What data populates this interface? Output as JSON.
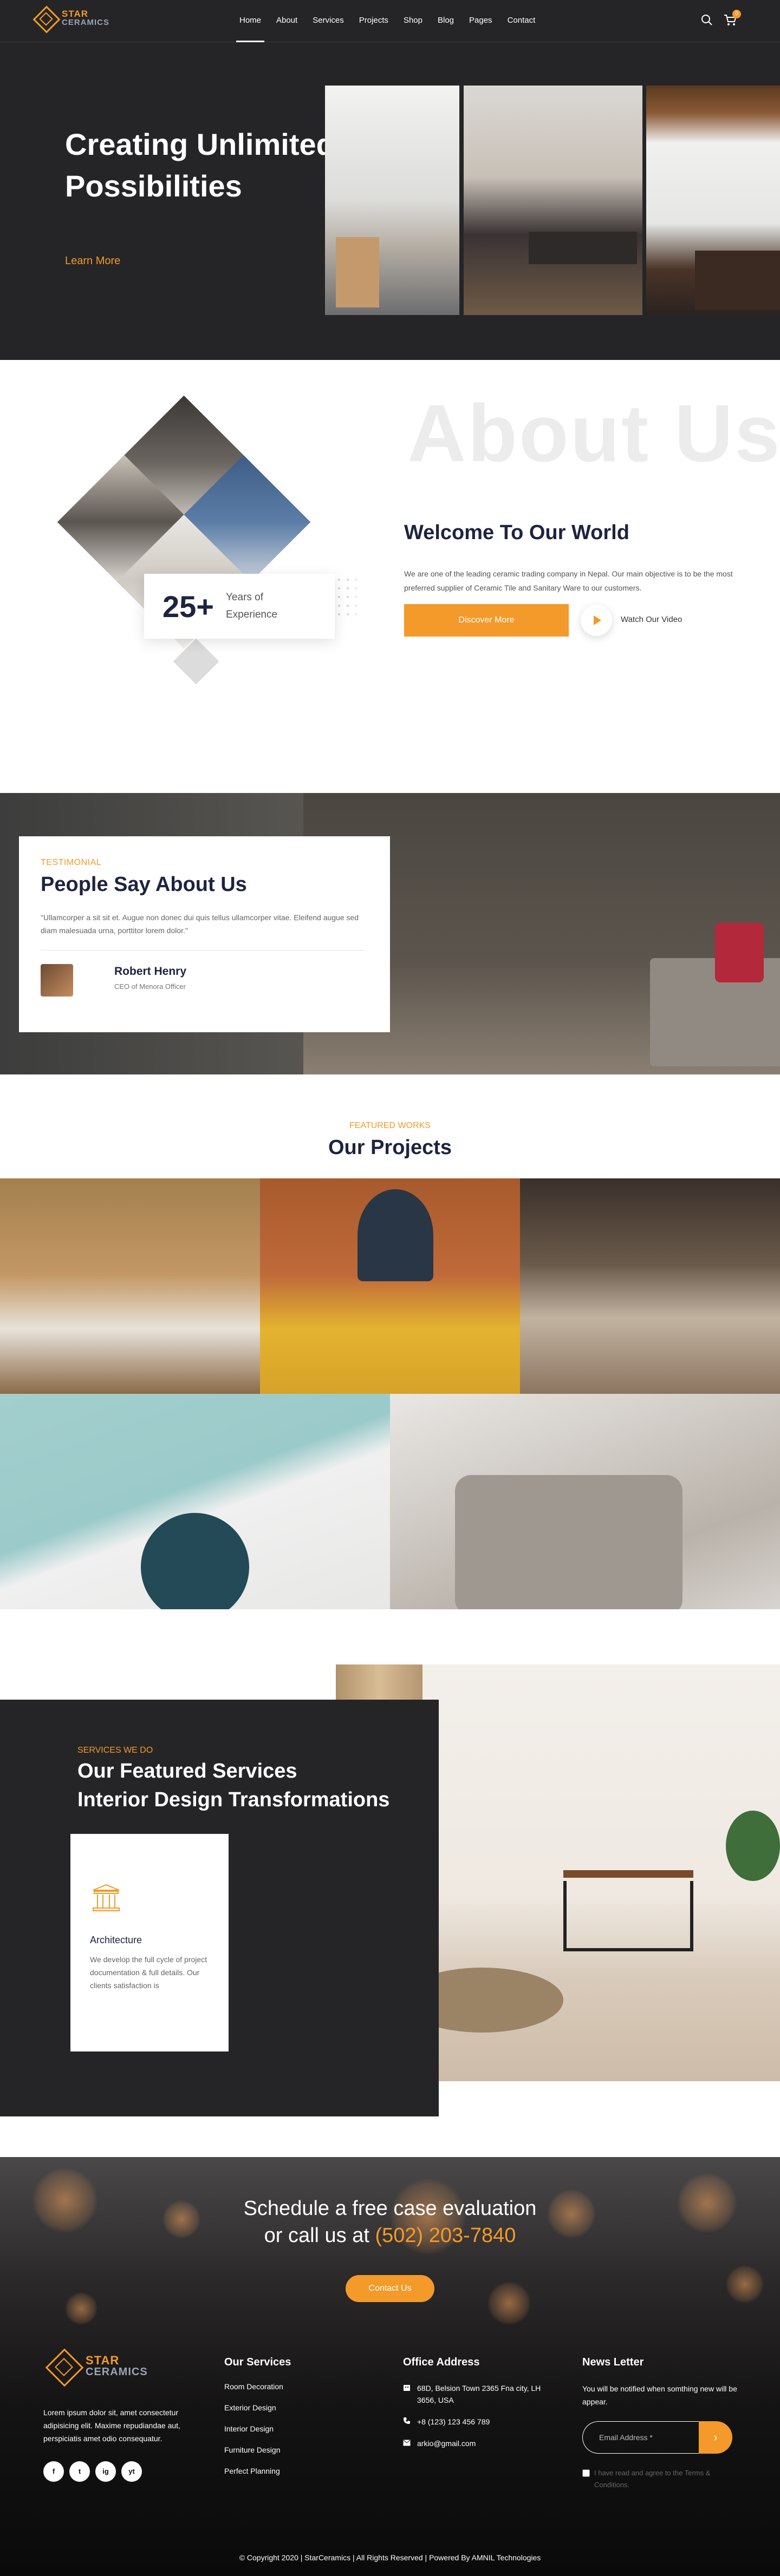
{
  "header": {
    "logo_line1": "STAR",
    "logo_line2": "CERAMICS",
    "nav": [
      "Home",
      "About",
      "Services",
      "Projects",
      "Shop",
      "Blog",
      "Pages",
      "Contact"
    ],
    "active_nav": "Home",
    "cart_count": "0"
  },
  "hero": {
    "title": "Creating Unlimited Possibilities",
    "link": "Learn More"
  },
  "about": {
    "bg_text": "About Us",
    "heading": "Welcome To Our World",
    "body": "We are one of the leading ceramic trading company in Nepal. Our main objective is to be the most preferred supplier of Ceramic Tile and Sanitary Ware to our customers.",
    "button": "Discover More",
    "video_label": "Watch Our Video",
    "years_number": "25+",
    "years_label": "Years of Experience"
  },
  "testimonial": {
    "tag": "TESTIMONIAL",
    "heading": "People Say About Us",
    "quote": "\"Ullamcorper a sit sit et. Augue non donec dui quis tellus ullamcorper vitae. Eleifend augue sed diam malesuada urna, porttitor lorem dolor.\"",
    "name": "Robert Henry",
    "role": "CEO of Menora Officer"
  },
  "projects": {
    "tag": "FEATURED WORKS",
    "heading": "Our Projects"
  },
  "services": {
    "tag": "SERVICES WE DO",
    "heading_line1": "Our Featured Services",
    "heading_line2": "Interior Design Transformations",
    "card_title": "Architecture",
    "card_text": "We develop the full cycle of project documentation & full details. Our clients satisfaction is"
  },
  "cta": {
    "line1": "Schedule a free case evaluation",
    "line2_prefix": "or call us at",
    "phone": "(502) 203-7840",
    "button": "Contact Us"
  },
  "footer": {
    "logo_line1": "STAR",
    "logo_line2": "CERAMICS",
    "about_text": "Lorem ipsum dolor sit, amet consectetur adipisicing elit. Maxime repudiandae aut, perspiciatis amet odio consequatur.",
    "socials": [
      "f",
      "t",
      "ig",
      "yt"
    ],
    "services_heading": "Our Services",
    "services": [
      "Room Decoration",
      "Exterior Design",
      "Interior Design",
      "Furniture Design",
      "Perfect Planning"
    ],
    "office_heading": "Office Address",
    "address": "68D, Belsion Town 2365 Fna city, LH 3656, USA",
    "phone": "+8 (123) 123 456 789",
    "email": "arkio@gmail.com",
    "news_heading": "News Letter",
    "news_text": "You will be notified when somthing new will be appear.",
    "email_placeholder": "Email Address *",
    "consent": "I have read and agree to the Terms & Conditions.",
    "copyright": "© Copyright 2020 | StarCeramics | All Rights Reserved | Powered By AMNIL Technologies"
  },
  "colors": {
    "accent": "#f39a2a",
    "dark": "#252527",
    "navy": "#1d2340"
  }
}
